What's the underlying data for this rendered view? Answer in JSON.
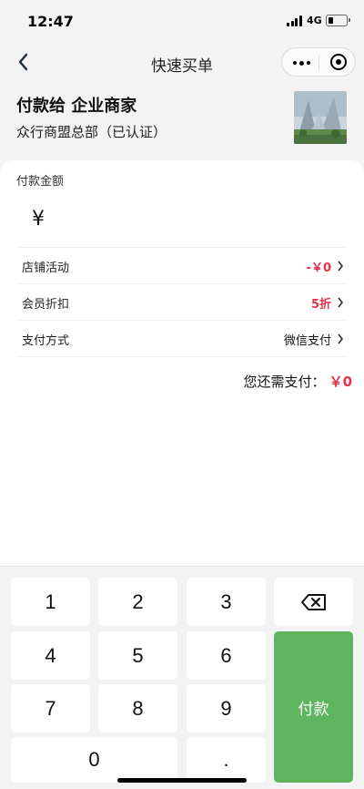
{
  "status_bar": {
    "time": "12:47",
    "network": "4G"
  },
  "nav": {
    "title": "快速买单"
  },
  "merchant": {
    "title": "付款给 企业商家",
    "subtitle": "众行商盟总部（已认证）"
  },
  "payment": {
    "amount_label": "付款金额",
    "currency_symbol": "¥",
    "rows": [
      {
        "label": "店铺活动",
        "value": "-￥0"
      },
      {
        "label": "会员折扣",
        "value": "5折"
      },
      {
        "label": "支付方式",
        "value": "微信支付"
      }
    ],
    "due_label": "您还需支付：",
    "due_amount": "￥0"
  },
  "keypad": {
    "keys": [
      "1",
      "2",
      "3",
      "4",
      "5",
      "6",
      "7",
      "8",
      "9",
      "0",
      "."
    ],
    "pay_label": "付款",
    "backspace_icon": "backspace-icon"
  },
  "colors": {
    "accent_red": "#e8304a",
    "pay_green": "#5fb55f"
  }
}
